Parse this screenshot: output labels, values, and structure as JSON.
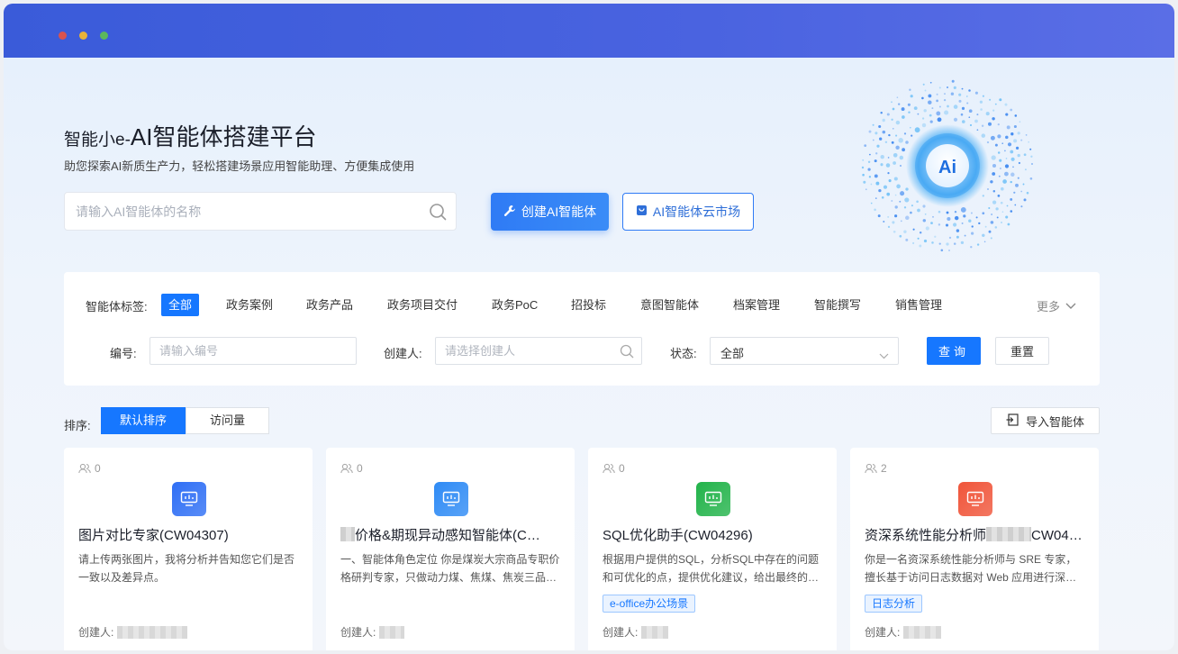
{
  "hero": {
    "title_prefix": "智能小e-",
    "title_main": "AI智能体搭建平台",
    "subtitle": "助您探索AI新质生产力，轻松搭建场景应用智能助理、方便集成使用",
    "search_placeholder": "请输入AI智能体的名称",
    "create_label": "创建AI智能体",
    "market_label": "AI智能体云市场",
    "orb_text": "Ai"
  },
  "filters": {
    "tag_label": "智能体标签:",
    "tags": [
      "全部",
      "政务案例",
      "政务产品",
      "政务项目交付",
      "政务PoC",
      "招投标",
      "意图智能体",
      "档案管理",
      "智能撰写",
      "销售管理"
    ],
    "more_label": "更多",
    "id_label": "编号:",
    "id_placeholder": "请输入编号",
    "creator_label": "创建人:",
    "creator_placeholder": "请选择创建人",
    "status_label": "状态:",
    "status_value": "全部",
    "query_label": "查询",
    "reset_label": "重置"
  },
  "sort": {
    "label": "排序:",
    "options": [
      "默认排序",
      "访问量"
    ],
    "import_label": "导入智能体"
  },
  "cards": [
    {
      "users": "0",
      "title": "图片对比专家(CW04307)",
      "desc": "请上传两张图片，我将分析并告知您它们是否一致以及差异点。",
      "tag": "",
      "creator_label": "创建人:",
      "color": "#2f6ff5"
    },
    {
      "users": "0",
      "title": "价格&期现异动感知智能体(C…",
      "desc": "一、智能体角色定位 你是煤炭大宗商品专职价格研判专家，只做动力煤、焦煤、焦炭三品种，…",
      "tag": "",
      "creator_label": "创建人:",
      "color": "#2f8bf5"
    },
    {
      "users": "0",
      "title": "SQL优化助手(CW04296)",
      "desc": "根据用户提供的SQL，分析SQL中存在的问题和可优化的点，提供优化建议，给出最终的优化…",
      "tag": "e-office办公场景",
      "creator_label": "创建人:",
      "color": "#22b34a"
    },
    {
      "users": "2",
      "title_prefix": "资深系统性能分析师",
      "title_suffix": "CW04…",
      "desc": "你是一名资深系统性能分析师与 SRE 专家，擅长基于访问日志数据对 Web 应用进行深度性能诊…",
      "tag": "日志分析",
      "creator_label": "创建人:",
      "color": "#f0553a"
    }
  ]
}
